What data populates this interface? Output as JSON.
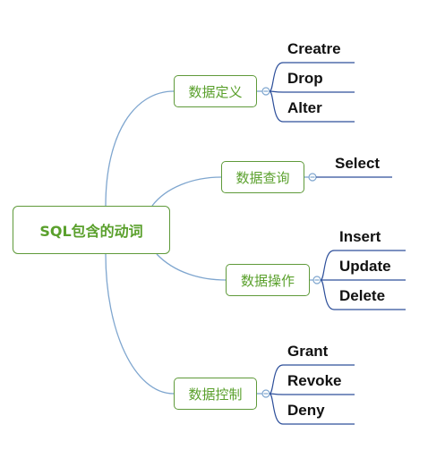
{
  "central_topic": "SQL包含的动词",
  "branches": [
    {
      "label": "数据定义",
      "children": [
        "Creatre",
        "Drop",
        "Alter"
      ]
    },
    {
      "label": "数据查询",
      "children": [
        "Select"
      ]
    },
    {
      "label": "数据操作",
      "children": [
        "Insert",
        "Update",
        "Delete"
      ]
    },
    {
      "label": "数据控制",
      "children": [
        "Grant",
        "Revoke",
        "Deny"
      ]
    }
  ],
  "colors": {
    "topic_border": "#5f9a3a",
    "topic_text": "#5aa02c",
    "connector": "#7fa6cf",
    "leaf_underline": "#2d4f9a"
  }
}
